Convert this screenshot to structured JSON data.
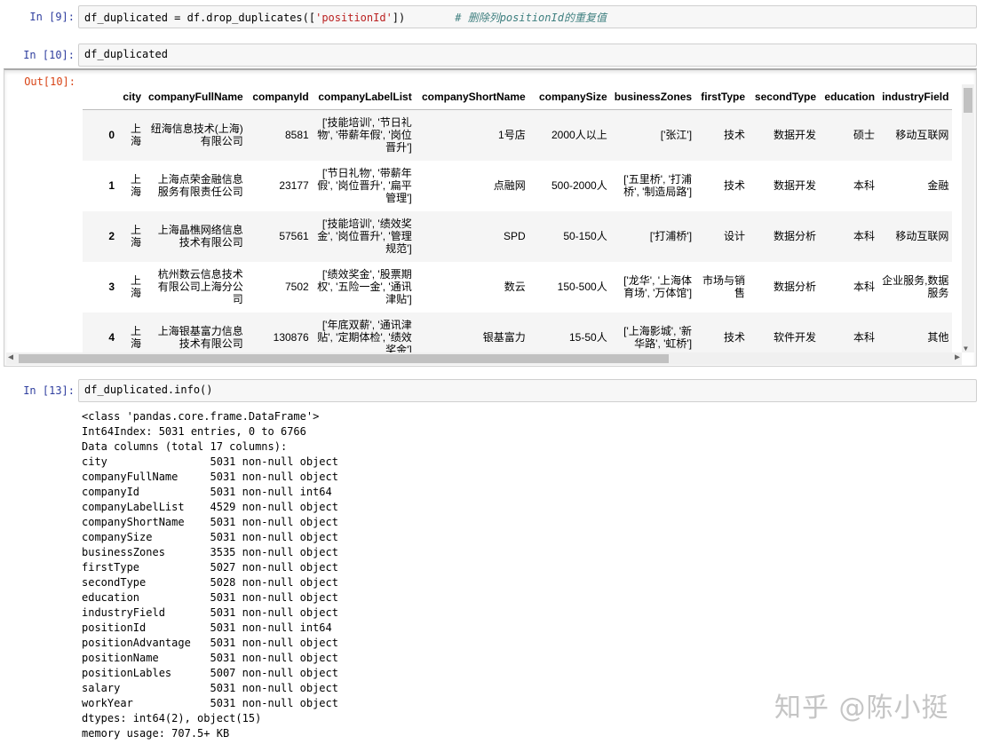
{
  "cells": {
    "in9": {
      "prompt": "In [9]:",
      "code_a": "df_duplicated = df.drop_duplicates([",
      "code_str": "'positionId'",
      "code_b": "])",
      "comment": "# 删除列positionId的重复值"
    },
    "in10": {
      "prompt": "In [10]:",
      "code": "df_duplicated"
    },
    "out10": {
      "prompt": "Out[10]:"
    },
    "in13": {
      "prompt": "In [13]:",
      "code": "df_duplicated.info()"
    }
  },
  "dataframe": {
    "columns": [
      "",
      "city",
      "companyFullName",
      "companyId",
      "companyLabelList",
      "companyShortName",
      "companySize",
      "businessZones",
      "firstType",
      "secondType",
      "education",
      "industryField"
    ],
    "rows": [
      [
        "0",
        "上海",
        "纽海信息技术(上海)有限公司",
        "8581",
        "['技能培训', '节日礼物', '带薪年假', '岗位晋升']",
        "1号店",
        "2000人以上",
        "['张江']",
        "技术",
        "数据开发",
        "硕士",
        "移动互联网"
      ],
      [
        "1",
        "上海",
        "上海点荣金融信息服务有限责任公司",
        "23177",
        "['节日礼物', '带薪年假', '岗位晋升', '扁平管理']",
        "点融网",
        "500-2000人",
        "['五里桥', '打浦桥', '制造局路']",
        "技术",
        "数据开发",
        "本科",
        "金融"
      ],
      [
        "2",
        "上海",
        "上海晶樵网络信息技术有限公司",
        "57561",
        "['技能培训', '绩效奖金', '岗位晋升', '管理规范']",
        "SPD",
        "50-150人",
        "['打浦桥']",
        "设计",
        "数据分析",
        "本科",
        "移动互联网"
      ],
      [
        "3",
        "上海",
        "杭州数云信息技术有限公司上海分公司",
        "7502",
        "['绩效奖金', '股票期权', '五险一金', '通讯津贴']",
        "数云",
        "150-500人",
        "['龙华', '上海体育场', '万体馆']",
        "市场与销售",
        "数据分析",
        "本科",
        "企业服务,数据服务"
      ],
      [
        "4",
        "上海",
        "上海银基富力信息技术有限公司",
        "130876",
        "['年底双薪', '通讯津贴', '定期体检', '绩效奖金']",
        "银基富力",
        "15-50人",
        "['上海影城', '新华路', '虹桥']",
        "技术",
        "软件开发",
        "本科",
        "其他"
      ]
    ]
  },
  "info_output": [
    "<class 'pandas.core.frame.DataFrame'>",
    "Int64Index: 5031 entries, 0 to 6766",
    "Data columns (total 17 columns):",
    "city                5031 non-null object",
    "companyFullName     5031 non-null object",
    "companyId           5031 non-null int64",
    "companyLabelList    4529 non-null object",
    "companyShortName    5031 non-null object",
    "companySize         5031 non-null object",
    "businessZones       3535 non-null object",
    "firstType           5027 non-null object",
    "secondType          5028 non-null object",
    "education           5031 non-null object",
    "industryField       5031 non-null object",
    "positionId          5031 non-null int64",
    "positionAdvantage   5031 non-null object",
    "positionName        5031 non-null object",
    "positionLables      5007 non-null object",
    "salary              5031 non-null object",
    "workYear            5031 non-null object",
    "dtypes: int64(2), object(15)",
    "memory usage: 707.5+ KB"
  ],
  "watermark": "知乎 @陈小挺",
  "icons": {
    "scroll_up": "up-arrow-icon",
    "scroll_down": "down-arrow-icon",
    "scroll_left": "left-arrow-icon",
    "scroll_right": "right-arrow-icon"
  }
}
